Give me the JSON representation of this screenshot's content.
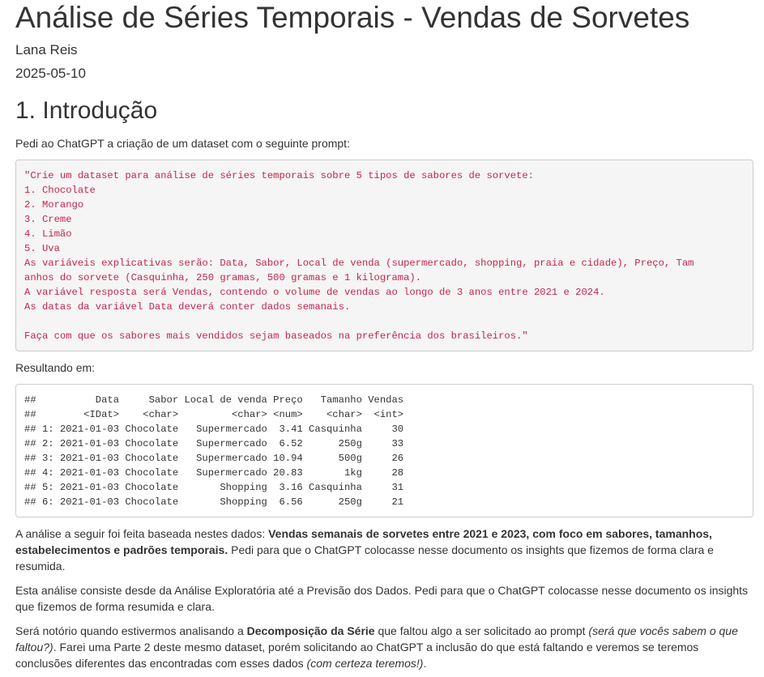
{
  "title": "Análise de Séries Temporais - Vendas de Sorvetes",
  "author": "Lana Reis",
  "date": "2025-05-10",
  "section1": {
    "heading": "1. Introdução",
    "intro": "Pedi ao ChatGPT a criação de um dataset com o seguinte prompt:",
    "prompt_lines": [
      "\"Crie um dataset para análise de séries temporais sobre 5 tipos de sabores de sorvete:",
      "1. Chocolate",
      "2. Morango",
      "3. Creme",
      "4. Limão",
      "5. Uva",
      "As variáveis explicativas serão: Data, Sabor, Local de venda (supermercado, shopping, praia e cidade), Preço, Tam",
      "anhos do sorvete (Casquinha, 250 gramas, 500 gramas e 1 kilograma).",
      "A variável resposta será Vendas, contendo o volume de vendas ao longo de 3 anos entre 2021 e 2024.",
      "As datas da variável Data deverá conter dados semanais.",
      "",
      "Faça com que os sabores mais vendidos sejam baseados na preferência dos brasileiros.\""
    ],
    "result_label": "Resultando em:",
    "output_lines": [
      "##          Data     Sabor Local de venda Preço   Tamanho Vendas",
      "##        <IDat>    <char>         <char> <num>    <char>  <int>",
      "## 1: 2021-01-03 Chocolate   Supermercado  3.41 Casquinha     30",
      "## 2: 2021-01-03 Chocolate   Supermercado  6.52      250g     33",
      "## 3: 2021-01-03 Chocolate   Supermercado 10.94      500g     26",
      "## 4: 2021-01-03 Chocolate   Supermercado 20.83       1kg     28",
      "## 5: 2021-01-03 Chocolate       Shopping  3.16 Casquinha     31",
      "## 6: 2021-01-03 Chocolate       Shopping  6.56      250g     21"
    ],
    "para1": {
      "t1": "A análise a seguir foi feita baseada nestes dados: ",
      "b1": "Vendas semanais de sorvetes entre 2021 e 2023, com foco em sabores, tamanhos, estabelecimentos e padrões temporais.",
      "t2": " Pedi para que o ChatGPT colocasse nesse documento os insights que fizemos de forma clara e resumida."
    },
    "para2": "Esta análise consiste desde da Análise Exploratória até a Previsão dos Dados. Pedi para que o ChatGPT colocasse nesse documento os insights que fizemos de forma resumida e clara.",
    "para3": {
      "t1": "Será notório quando estivermos analisando a ",
      "b1": "Decomposição da Série",
      "t2": " que faltou algo a ser solicitado ao prompt ",
      "i1": "(será que vocês sabem o que faltou?)",
      "t3": ". Farei uma Parte 2 deste mesmo dataset, porém solicitando ao ChatGPT a inclusão do que está faltando e veremos se teremos conclusões diferentes das encontradas com esses dados ",
      "i2": "(com certeza teremos!)",
      "t4": "."
    }
  }
}
